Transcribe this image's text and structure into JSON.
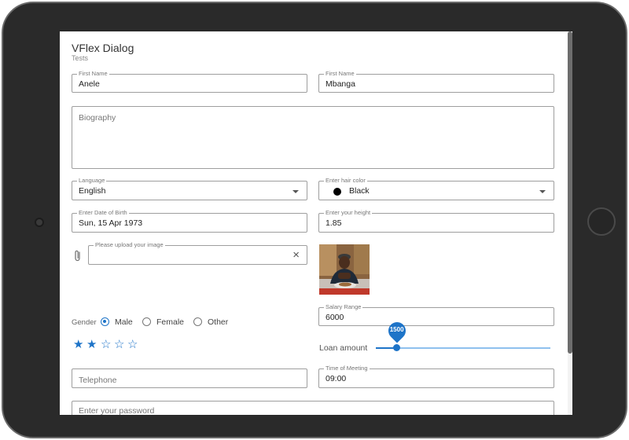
{
  "dialog": {
    "title": "VFlex Dialog",
    "subtitle": "Tests"
  },
  "fields": {
    "first_name": {
      "label": "First Name",
      "value": "Anele"
    },
    "last_name": {
      "label": "First Name",
      "value": "Mbanga"
    },
    "biography": {
      "placeholder": "Biography"
    },
    "language": {
      "label": "Language",
      "value": "English"
    },
    "hair_color": {
      "label": "Enter hair color",
      "value": "Black",
      "swatch": "#000000"
    },
    "birth_date": {
      "label": "Enter Date of Birth",
      "value": "Sun, 15 Apr 1973"
    },
    "height": {
      "label": "Enter your height",
      "value": "1.85"
    },
    "image_upload": {
      "label": "Please upload your image",
      "clear_icon": "×"
    },
    "salary_range": {
      "label": "Salary Range",
      "value": "6000"
    },
    "telephone": {
      "placeholder": "Telephone"
    },
    "meeting_time": {
      "label": "Time of Meeting",
      "value": "09:00"
    },
    "password": {
      "placeholder": "Enter your password"
    }
  },
  "gender": {
    "label": "Gender",
    "options": [
      "Male",
      "Female",
      "Other"
    ],
    "selected": "Male"
  },
  "rating": {
    "value": 2,
    "max": 5,
    "filled_glyph": "★",
    "empty_glyph": "☆"
  },
  "loan": {
    "label": "Loan amount",
    "value": "1500",
    "fraction": 0.12
  },
  "icons": {
    "attach": "paperclip-icon",
    "dropdown": "chevron-down-icon",
    "clear": "close-icon"
  },
  "colors": {
    "accent": "#1e74c8",
    "border": "#9e9e9e"
  }
}
